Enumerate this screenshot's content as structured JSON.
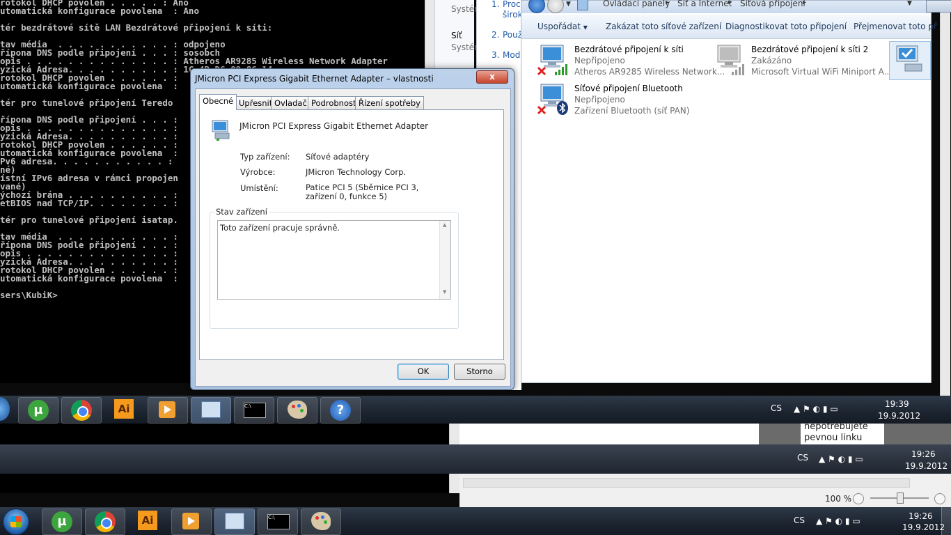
{
  "console": {
    "lines": [
      "rotokol DHCP povolen . . . . . : Ano",
      "utomatická konfigurace povolena  : Ano",
      "",
      "tér bezdrátové sítě LAN Bezdrátové připojení k síti:",
      "",
      "tav média  . . . . . . . . . . . : odpojeno",
      "řípona DNS podle připojení . . . : sosobch",
      "opis . . . . . . . . . . . . . . : Atheros AR9285 Wireless Network Adapter",
      "yzická Adresa. . . . . . . . . . : 1C-4B-D6-09-86-14",
      "rotokol DHCP povolen . . . . . . :",
      "utomatická konfigurace povolena  :",
      "",
      "tér pro tunelové připojení Teredo",
      "",
      "řípona DNS podle připojení . . . :",
      "opis . . . . . . . . . . . . . . :",
      "yzická Adresa. . . . . . . . . . :",
      "rotokol DHCP povolen . . . . . . :",
      "utomatická konfigurace povolena  :",
      "Pv6 adresa. . . . . . . . . . . :",
      "né)",
      "ístní IPv6 adresa v rámci propojen",
      "vané)",
      "ýchozí brána . . . . . . . . . . :",
      "etBIOS nad TCP/IP. . . . . . . . :",
      "",
      "tér pro tunelové připojení isatap.",
      "",
      "tav média  . . . . . . . . . . . :",
      "řípona DNS podle připojení . . . :",
      "opis . . . . . . . . . . . . . . :",
      "yzická Adresa. . . . . . . . . . :",
      "rotokol DHCP povolen . . . . . . :",
      "utomatická konfigurace povolena  :",
      "",
      "sers\\KubiK>"
    ]
  },
  "background_fragments": {
    "system1": "Systém",
    "sit": "Síť",
    "system2": "Systém",
    "proc": "Proc",
    "sirok": "širok",
    "pouz": "Použ",
    "mod": "Mod",
    "n1": "1.",
    "n2": "2.",
    "n3": "3.",
    "nepotrebujete": "nepotřebujete",
    "pevnou_linku": "pevnou linku",
    "zoom": "100 %"
  },
  "explorer": {
    "breadcrumb": [
      "Ovládací panely",
      "Síť a Internet",
      "Síťová připojení"
    ],
    "toolbar": [
      "Uspořádat",
      "Zakázat toto síťové zařízení",
      "Diagnostikovat toto připojení",
      "Přejmenovat toto př"
    ],
    "connections": [
      {
        "name": "Bezdrátové připojení k síti",
        "status": "Nepřipojeno",
        "device": "Atheros AR9285 Wireless Network..."
      },
      {
        "name": "Bezdrátové připojení k síti 2",
        "status": "Zakázáno",
        "device": "Microsoft Virtual WiFi Miniport A..."
      },
      {
        "name": "Síťové připojení Bluetooth",
        "status": "Nepřipojeno",
        "device": "Zařízení Bluetooth (síť PAN)"
      }
    ]
  },
  "dialog": {
    "title": "JMicron PCI Express Gigabit Ethernet Adapter – vlastnosti",
    "tabs": [
      "Obecné",
      "Upřesnit",
      "Ovladač",
      "Podrobnosti",
      "Řízení spotřeby"
    ],
    "device_name": "JMicron PCI Express Gigabit Ethernet Adapter",
    "props": [
      {
        "label": "Typ zařízení:",
        "value": "Síťové adaptéry"
      },
      {
        "label": "Výrobce:",
        "value": "JMicron Technology Corp."
      },
      {
        "label": "Umístění:",
        "value": "Patice PCI 5 (Sběrnice PCI 3, zařízení 0, funkce 5)"
      }
    ],
    "group_title": "Stav zařízení",
    "status_text": "Toto zařízení pracuje správně.",
    "ok": "OK",
    "cancel": "Storno",
    "close": "x"
  },
  "taskbar_top": {
    "lang": "CS",
    "time": "19:39",
    "date": "19.9.2012"
  },
  "taskbar_mid": {
    "lang": "CS",
    "time": "19:26",
    "date": "19.9.2012"
  },
  "taskbar_bottom": {
    "lang": "CS",
    "time": "19:26",
    "date": "19.9.2012"
  }
}
